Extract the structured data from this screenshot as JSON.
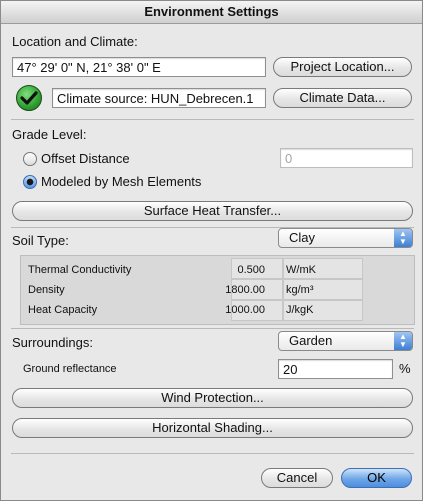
{
  "window": {
    "title": "Environment Settings"
  },
  "location": {
    "heading": "Location and Climate:",
    "coordinates": "47° 29' 0\" N, 21° 38' 0\" E",
    "project_location_button": "Project Location...",
    "climate_source": "Climate source: HUN_Debrecen.1",
    "climate_data_button": "Climate Data..."
  },
  "grade": {
    "heading": "Grade Level:",
    "offset_label": "Offset Distance",
    "offset_value": "0",
    "modeled_label": "Modeled by Mesh Elements",
    "selected": "Modeled by Mesh Elements",
    "surface_button": "Surface Heat Transfer..."
  },
  "soil": {
    "heading": "Soil Type:",
    "selected": "Clay",
    "properties": [
      {
        "name": "Thermal Conductivity",
        "value": "0.500",
        "unit": "W/mK"
      },
      {
        "name": "Density",
        "value": "1800.00",
        "unit": "kg/m³"
      },
      {
        "name": "Heat Capacity",
        "value": "1000.00",
        "unit": "J/kgK"
      }
    ]
  },
  "surroundings": {
    "heading": "Surroundings:",
    "selected": "Garden",
    "reflectance_label": "Ground reflectance",
    "reflectance_value": "20",
    "reflectance_unit": "%",
    "wind_button": "Wind Protection...",
    "shading_button": "Horizontal Shading..."
  },
  "footer": {
    "cancel": "Cancel",
    "ok": "OK"
  },
  "colors": {
    "check_green": "#2f9e2f",
    "ok_blue": "#4d8ee0"
  }
}
